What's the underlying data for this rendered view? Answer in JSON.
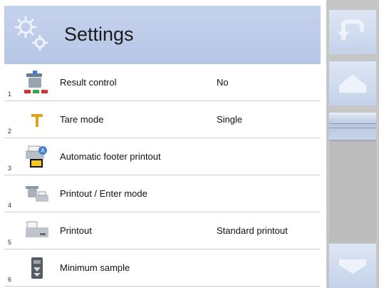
{
  "header": {
    "title": "Settings",
    "icon": "gears-icon"
  },
  "rows": [
    {
      "number": "1",
      "label": "Result control",
      "value": "No",
      "icon": "scale-check-icon"
    },
    {
      "number": "2",
      "label": "Tare mode",
      "value": "Single",
      "icon": "tare-t-icon"
    },
    {
      "number": "3",
      "label": "Automatic footer printout",
      "value": "",
      "icon": "auto-printer-icon"
    },
    {
      "number": "4",
      "label": "Printout / Enter mode",
      "value": "",
      "icon": "scale-printer-icon"
    },
    {
      "number": "5",
      "label": "Printout",
      "value": "Standard printout",
      "icon": "printer-icon"
    },
    {
      "number": "6",
      "label": "Minimum sample",
      "value": "",
      "icon": "minimum-sample-icon"
    }
  ],
  "sidebar": {
    "buttons": [
      "back-icon",
      "home-icon",
      "scroll-down-icon"
    ],
    "slider_position": 0
  },
  "colors": {
    "header": "#b9c8e6",
    "sidebar": "#c6c6c6",
    "button": "#d4def0"
  }
}
